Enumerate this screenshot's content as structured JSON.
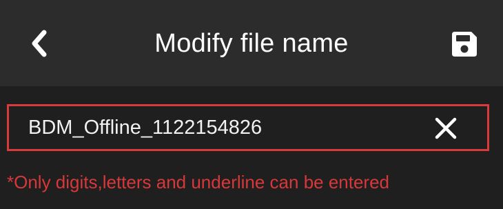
{
  "header": {
    "title": "Modify file name",
    "back_icon": "chevron-left-icon",
    "save_icon": "save-icon"
  },
  "filename_input": {
    "value": "BDM_Offline_1122154826",
    "clear_icon": "close-icon"
  },
  "hint_text": "*Only digits,letters and underline can be entered",
  "colors": {
    "header_bg": "#2c2c2c",
    "page_bg": "#1f1f1f",
    "accent_red": "#d93a3a",
    "text_white": "#ffffff"
  }
}
